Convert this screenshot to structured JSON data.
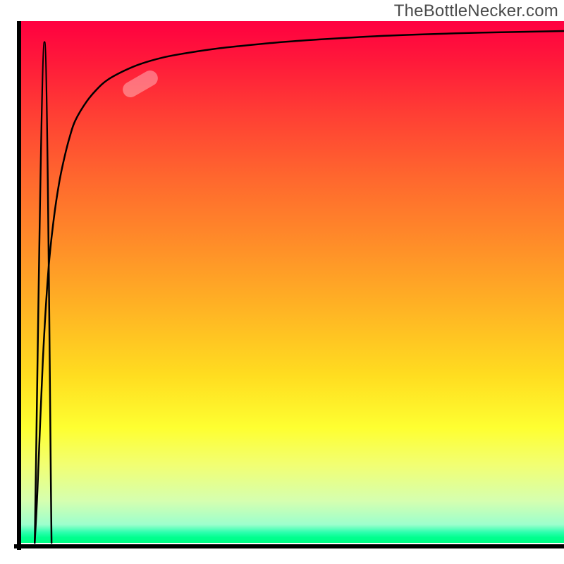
{
  "attribution": "TheBottleNecker.com",
  "colors": {
    "axis": "#000000",
    "curve": "#000000",
    "marker_fill": "rgba(255,255,255,0.35)"
  },
  "chart_data": {
    "type": "line",
    "title": "",
    "xlabel": "",
    "ylabel": "",
    "xlim": [
      0,
      100
    ],
    "ylim": [
      0,
      100
    ],
    "x": [
      2.5,
      3,
      4,
      5,
      6,
      7,
      8,
      9,
      10,
      12,
      14,
      16,
      19,
      22,
      26,
      30,
      35,
      40,
      47,
      55,
      65,
      75,
      85,
      95,
      100
    ],
    "values": [
      0,
      10,
      35,
      52,
      62,
      69,
      74,
      78,
      81,
      84.5,
      87,
      88.8,
      90.5,
      91.8,
      93,
      93.8,
      94.6,
      95.2,
      95.9,
      96.5,
      97.1,
      97.5,
      97.8,
      98,
      98.1
    ],
    "spike": {
      "x": [
        2.5,
        4.3,
        5.6
      ],
      "values": [
        0,
        96,
        0
      ]
    },
    "marker": {
      "x": 22,
      "y": 88,
      "angle_deg": -30
    }
  }
}
